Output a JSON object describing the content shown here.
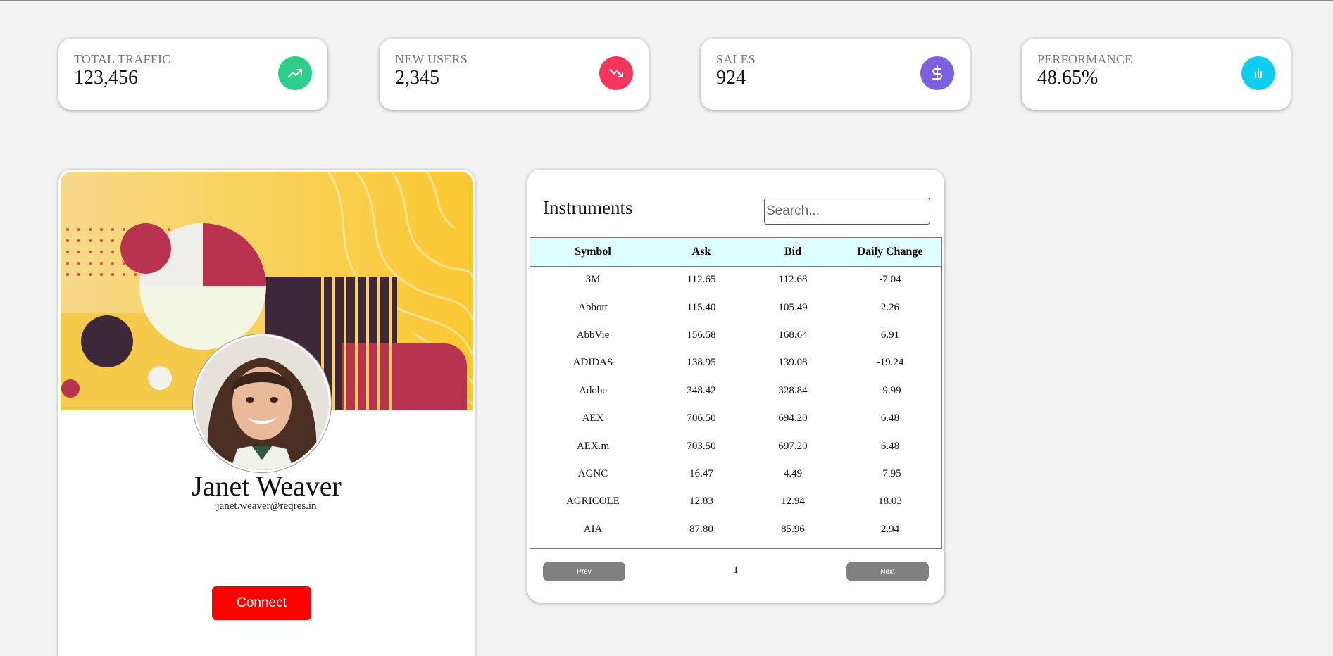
{
  "stats": [
    {
      "label": "TOTAL TRAFFIC",
      "value": "123,456",
      "icon": "trending-up-icon",
      "color": "#2dce89"
    },
    {
      "label": "NEW USERS",
      "value": "2,345",
      "icon": "trending-down-icon",
      "color": "#f5365c"
    },
    {
      "label": "SALES",
      "value": "924",
      "icon": "dollar-icon",
      "color": "#7b61e0"
    },
    {
      "label": "PERFORMANCE",
      "value": "48.65%",
      "icon": "bar-chart-icon",
      "color": "#11cdef"
    }
  ],
  "profile": {
    "name": "Janet Weaver",
    "email": "janet.weaver@reqres.in",
    "connect_label": "Connect",
    "connect_color": "#ff0000"
  },
  "instruments": {
    "title": "Instruments",
    "search_placeholder": "Search...",
    "columns": [
      "Symbol",
      "Ask",
      "Bid",
      "Daily Change"
    ],
    "rows": [
      [
        "3M",
        "112.65",
        "112.68",
        "-7.04"
      ],
      [
        "Abbott",
        "115.40",
        "105.49",
        "2.26"
      ],
      [
        "AbbVie",
        "156.58",
        "168.64",
        "6.91"
      ],
      [
        "ADIDAS",
        "138.95",
        "139.08",
        "-19.24"
      ],
      [
        "Adobe",
        "348.42",
        "328.84",
        "-9.99"
      ],
      [
        "AEX",
        "706.50",
        "694.20",
        "6.48"
      ],
      [
        "AEX.m",
        "703.50",
        "697.20",
        "6.48"
      ],
      [
        "AGNC",
        "16.47",
        "4.49",
        "-7.95"
      ],
      [
        "AGRICOLE",
        "12.83",
        "12.94",
        "18.03"
      ],
      [
        "AIA",
        "87.80",
        "85.96",
        "2.94"
      ]
    ],
    "prev_label": "Prev",
    "next_label": "Next",
    "page": "1",
    "header_color": "#dfffff"
  }
}
